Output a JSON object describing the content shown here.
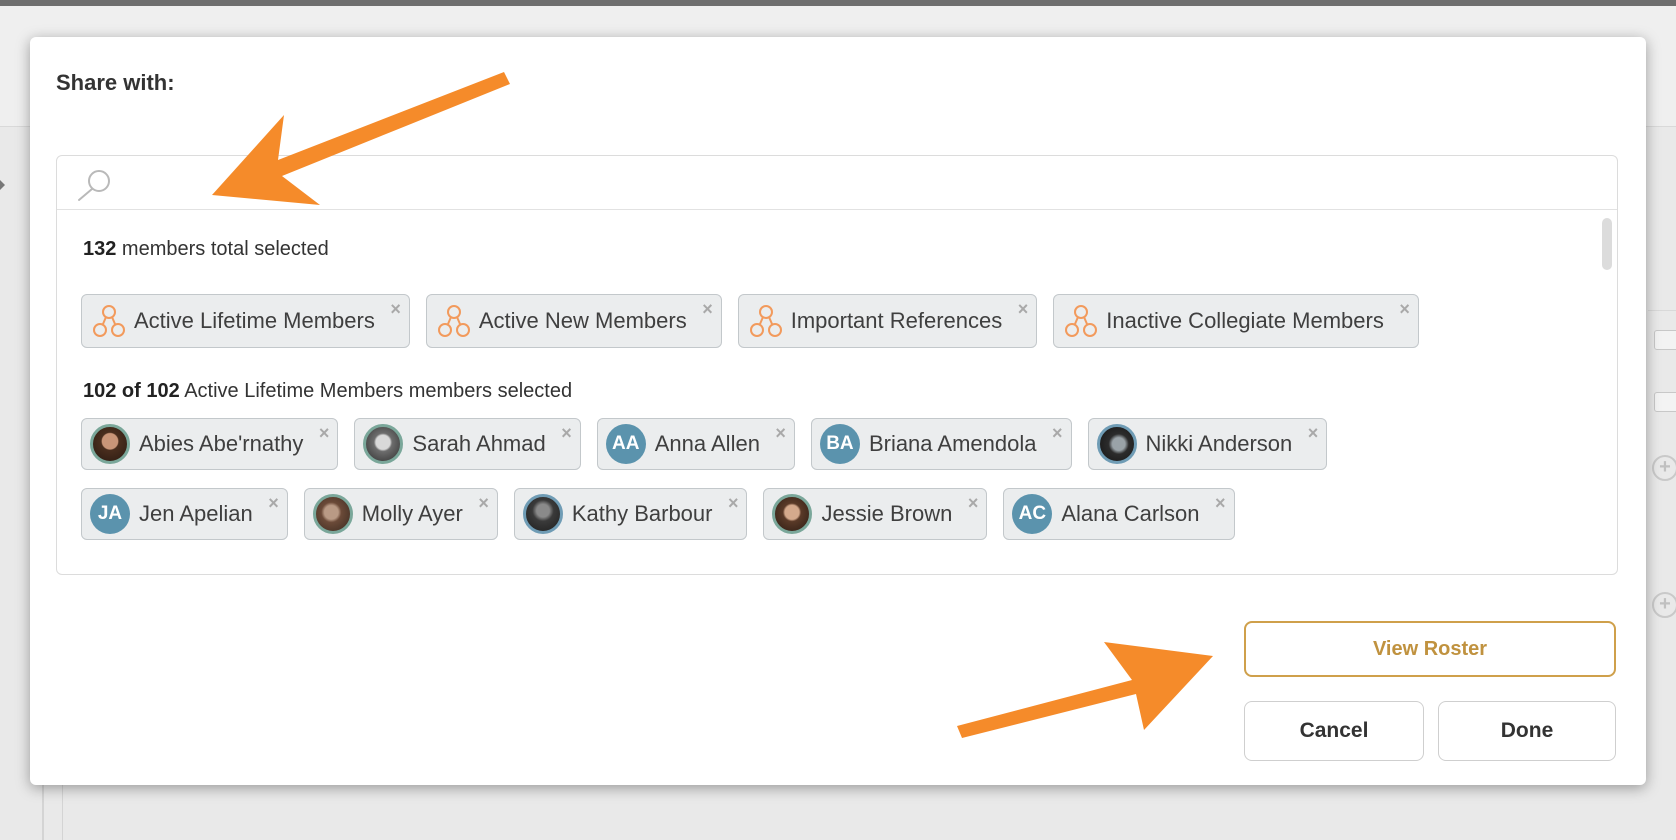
{
  "modal": {
    "title": "Share with:"
  },
  "search": {
    "value": "",
    "placeholder": ""
  },
  "summary_total": {
    "count": "132",
    "text": " members total selected"
  },
  "groups": [
    {
      "label": "Active Lifetime Members"
    },
    {
      "label": "Active New Members"
    },
    {
      "label": "Important References"
    },
    {
      "label": "Inactive Collegiate Members"
    }
  ],
  "summary_group": {
    "count": "102 of 102",
    "text": " Active Lifetime Members members selected"
  },
  "members_row1": [
    {
      "name": "Abies Abe'rnathy",
      "initials": ""
    },
    {
      "name": "Sarah Ahmad",
      "initials": ""
    },
    {
      "name": "Anna Allen",
      "initials": "AA"
    },
    {
      "name": "Briana Amendola",
      "initials": "BA"
    },
    {
      "name": "Nikki Anderson",
      "initials": ""
    }
  ],
  "members_row2": [
    {
      "name": "Jen Apelian",
      "initials": "JA"
    },
    {
      "name": "Molly Ayer",
      "initials": ""
    },
    {
      "name": "Kathy Barbour",
      "initials": ""
    },
    {
      "name": "Jessie Brown",
      "initials": ""
    },
    {
      "name": "Alana Carlson",
      "initials": "AC"
    }
  ],
  "remove_glyph": "×",
  "buttons": {
    "view_roster": "View Roster",
    "cancel": "Cancel",
    "done": "Done"
  },
  "colors": {
    "accent_gold": "#cfa04b",
    "group_icon": "#f29a5c",
    "initials_avatar": "#5b93ad",
    "annotation_arrow": "#f58b2a"
  },
  "icons": {
    "search": "search-icon",
    "group": "group-icon",
    "remove": "close-icon",
    "annotation": "arrow-icon"
  }
}
